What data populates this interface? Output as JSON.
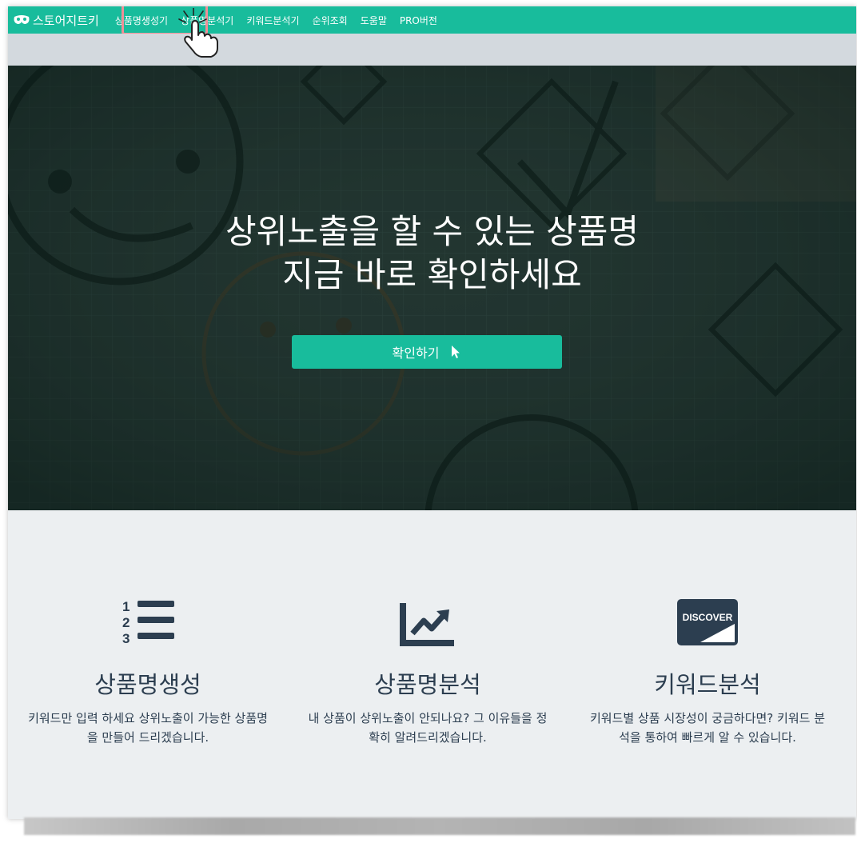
{
  "navbar": {
    "brand": "스토어지트키",
    "items": [
      "상품명생성기",
      "상품명분석기",
      "키워드분석기",
      "순위조회",
      "도움말",
      "PRO버전"
    ]
  },
  "hero": {
    "title_line1": "상위노출을 할 수 있는 상품명",
    "title_line2": "지금 바로 확인하세요",
    "button_label": "확인하기"
  },
  "features": [
    {
      "icon": "numbered-list-icon",
      "title": "상품명생성",
      "desc": "키워드만 입력 하세요 상위노출이 가능한 상품명을 만들어 드리겠습니다."
    },
    {
      "icon": "line-chart-icon",
      "title": "상품명분석",
      "desc": "내 상품이 상위노출이 안되나요? 그 이유들을 정확히 알려드리겠습니다."
    },
    {
      "icon": "discover-card-icon",
      "title": "키워드분석",
      "desc": "키워드별 상품 시장성이 궁금하다면? 키워드 분석을 통하여 빠르게 알 수 있습니다."
    }
  ],
  "discover_label": "DISCOVER",
  "colors": {
    "accent": "#18bc9c",
    "text": "#2c3e50",
    "highlight": "#ef8f97"
  }
}
